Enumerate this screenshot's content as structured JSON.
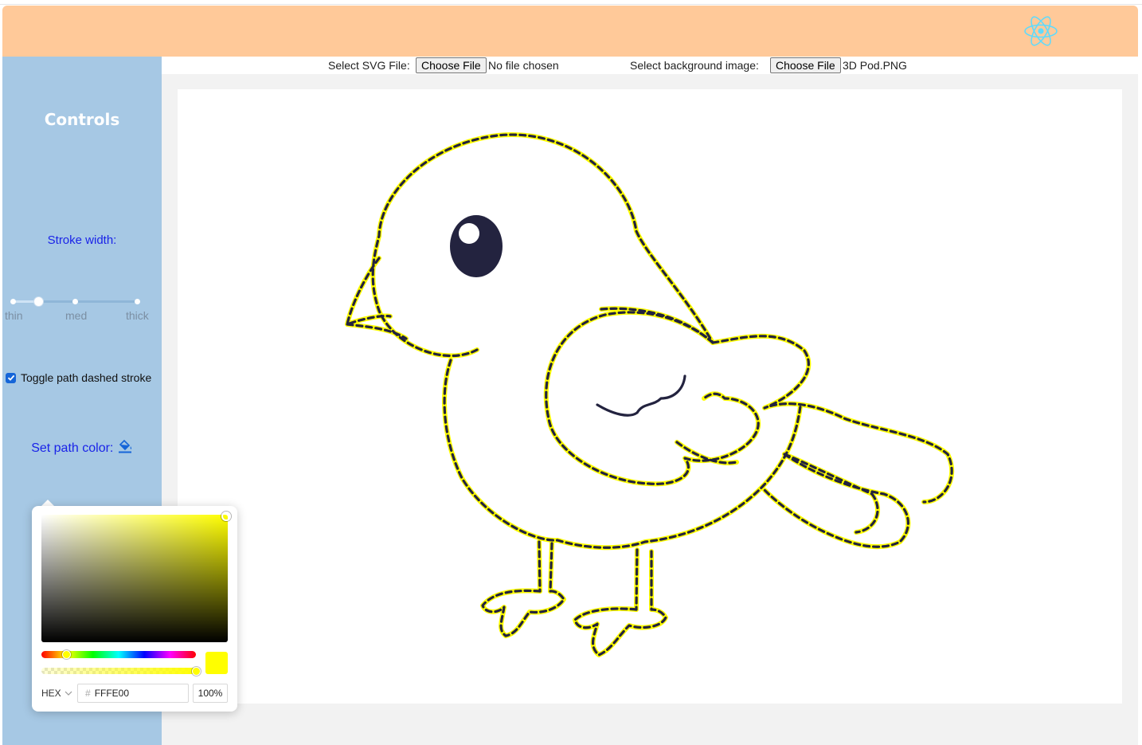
{
  "header": {
    "logo_icon": "react-atom-icon",
    "bg_color": "#ffc999"
  },
  "sidebar": {
    "title": "Controls",
    "stroke_width_label": "Stroke width:",
    "stroke_width": {
      "marks": [
        "thin",
        "med",
        "thick"
      ],
      "value_position": 0.2
    },
    "dashed_toggle": {
      "label": "Toggle path dashed stroke",
      "checked": true
    },
    "path_color_label": "Set path color:",
    "path_color_icon": "paint-bucket-icon"
  },
  "file_inputs": {
    "svg": {
      "label": "Select SVG File:",
      "button": "Choose File",
      "status": "No file chosen"
    },
    "background": {
      "label": "Select background image:",
      "button": "Choose File",
      "status": "3D Pod.PNG"
    }
  },
  "color_picker": {
    "format": "HEX",
    "hex_value": "FFFE00",
    "alpha": "100%",
    "color": "#fffe00"
  },
  "canvas": {
    "image": "bird-outline-drawing",
    "stroke_color": "#fffe00",
    "outline_color": "#23233f"
  }
}
